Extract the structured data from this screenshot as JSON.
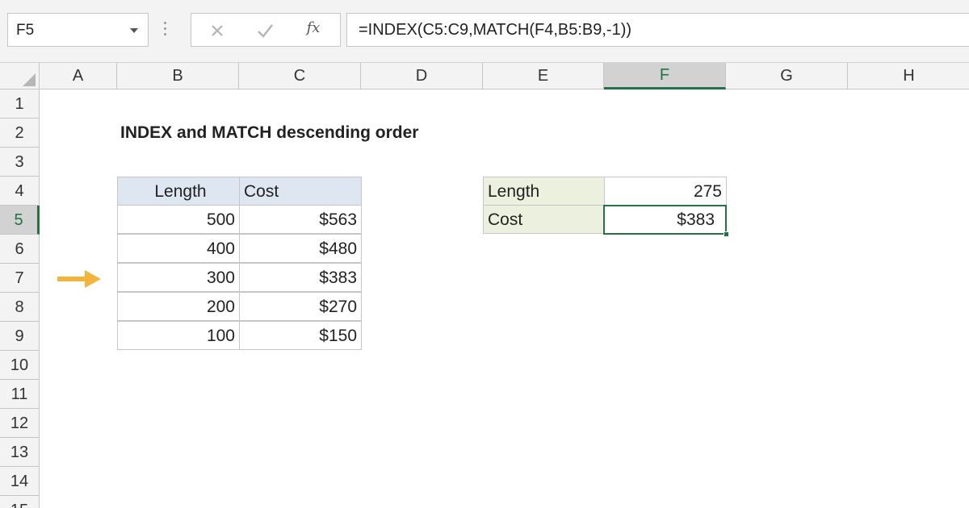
{
  "formula_bar": {
    "name_box": "F5",
    "formula": "=INDEX(C5:C9,MATCH(F4,B5:B9,-1))",
    "fx_label": "fx"
  },
  "columns": [
    "A",
    "B",
    "C",
    "D",
    "E",
    "F",
    "G",
    "H"
  ],
  "active_column": "F",
  "rows": [
    "1",
    "2",
    "3",
    "4",
    "5",
    "6",
    "7",
    "8",
    "9",
    "10",
    "11",
    "12",
    "13",
    "14",
    "15"
  ],
  "active_row": "5",
  "sheet": {
    "title": "INDEX and MATCH descending order",
    "data_table": {
      "headers": [
        "Length",
        "Cost"
      ],
      "rows": [
        [
          "500",
          "$563"
        ],
        [
          "400",
          "$480"
        ],
        [
          "300",
          "$383"
        ],
        [
          "200",
          "$270"
        ],
        [
          "100",
          "$150"
        ]
      ]
    },
    "lookup_table": {
      "length_label": "Length",
      "length_value": "275",
      "cost_label": "Cost",
      "cost_value": "$383"
    }
  },
  "colors": {
    "accent_green": "#217346",
    "arrow": "#f2b53a",
    "header_blue": "#dde6f1",
    "header_green": "#ebf1de"
  },
  "icons": {
    "cancel": "close-icon",
    "enter": "checkmark-icon",
    "insert_function": "fx-icon",
    "arrow": "arrow-right-icon"
  }
}
